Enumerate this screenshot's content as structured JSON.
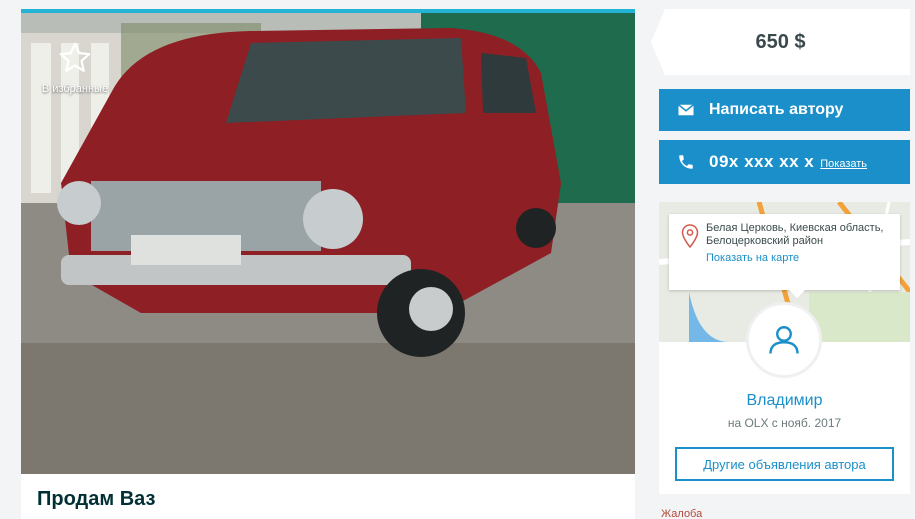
{
  "gallery": {
    "favorite_label": "В избранные"
  },
  "ad": {
    "title": "Продам Ваз"
  },
  "price": {
    "value": "650 $"
  },
  "contact": {
    "write_label": "Написать автору",
    "phone": "09x xxx xx x",
    "show_label": "Показать"
  },
  "location": {
    "address": "Белая Церковь, Киевская область, Белоцерковский район",
    "map_link": "Показать на карте"
  },
  "seller": {
    "name": "Владимир",
    "since": "на OLX с нояб. 2017",
    "other_ads_label": "Другие объявления автора"
  },
  "complaint_label": "Жалоба",
  "colors": {
    "accent": "#1b8fc9",
    "car": "#8e1f24",
    "text": "#002f34"
  },
  "icons": [
    "star-icon",
    "envelope-icon",
    "phone-icon",
    "map-pin-icon",
    "user-icon"
  ]
}
